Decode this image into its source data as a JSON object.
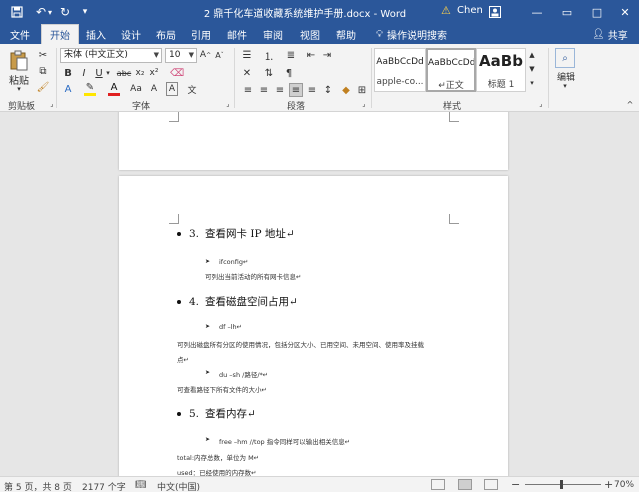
{
  "titlebar": {
    "title": "2 鼎千化车道收藏系统维护手册.docx - Word",
    "user": "Chen",
    "save_icon": "save-icon",
    "undo_icon": "undo-icon",
    "redo_icon": "redo-icon"
  },
  "tabs": [
    "文件",
    "开始",
    "插入",
    "设计",
    "布局",
    "引用",
    "邮件",
    "审阅",
    "视图",
    "帮助"
  ],
  "tell_me": "操作说明搜索",
  "share": "共享",
  "ribbon": {
    "clipboard": {
      "paste": "粘贴",
      "label": "剪贴板"
    },
    "font": {
      "name": "宋体 (中文正文)",
      "size": "10",
      "label": "字体",
      "buttons": [
        "B",
        "I",
        "U",
        "abc",
        "x₂",
        "x²",
        "A",
        "A",
        "A",
        "Aa"
      ]
    },
    "paragraph": {
      "label": "段落"
    },
    "styles": {
      "label": "样式",
      "items": [
        {
          "sample": "AaBbCcDd",
          "name": "apple-co..."
        },
        {
          "sample": "AaBbCcDd",
          "name": "↵正文"
        },
        {
          "sample": "AaBb",
          "name": "标题 1"
        }
      ]
    },
    "editing": {
      "label": "编辑"
    }
  },
  "document": {
    "sections": [
      {
        "heading_num": "3.",
        "heading": "查看网卡 IP 地址↵",
        "lines": [
          {
            "kind": "cmd",
            "text": "ifconfig↵"
          },
          {
            "kind": "desc",
            "text": "可列出当前活动的所有网卡信息↵"
          }
        ]
      },
      {
        "heading_num": "4.",
        "heading": "查看磁盘空间占用↵",
        "lines": [
          {
            "kind": "cmd",
            "text": "df –lh↵"
          },
          {
            "kind": "body",
            "text": "可列出磁盘所有分区的使用情况，包括分区大小、已用空间、未用空间、使用率及挂载"
          },
          {
            "kind": "body",
            "text": "点↵"
          },
          {
            "kind": "cmd",
            "text": "du –sh /路径/*↵"
          },
          {
            "kind": "body",
            "text": "可查看路径下所有文件的大小↵"
          }
        ]
      },
      {
        "heading_num": "5.",
        "heading": "查看内存↵",
        "lines": [
          {
            "kind": "cmd",
            "text": "free –hm    //top 指令同样可以输出相关信息↵"
          },
          {
            "kind": "body",
            "text": "total:内存总数，单位为 M↵"
          },
          {
            "kind": "body",
            "text": "used：已经使用的内存数↵"
          }
        ]
      }
    ]
  },
  "status": {
    "page": "第 5 页，共 8 页",
    "words": "2177 个字",
    "language": "中文(中国)",
    "zoom": "70%"
  }
}
